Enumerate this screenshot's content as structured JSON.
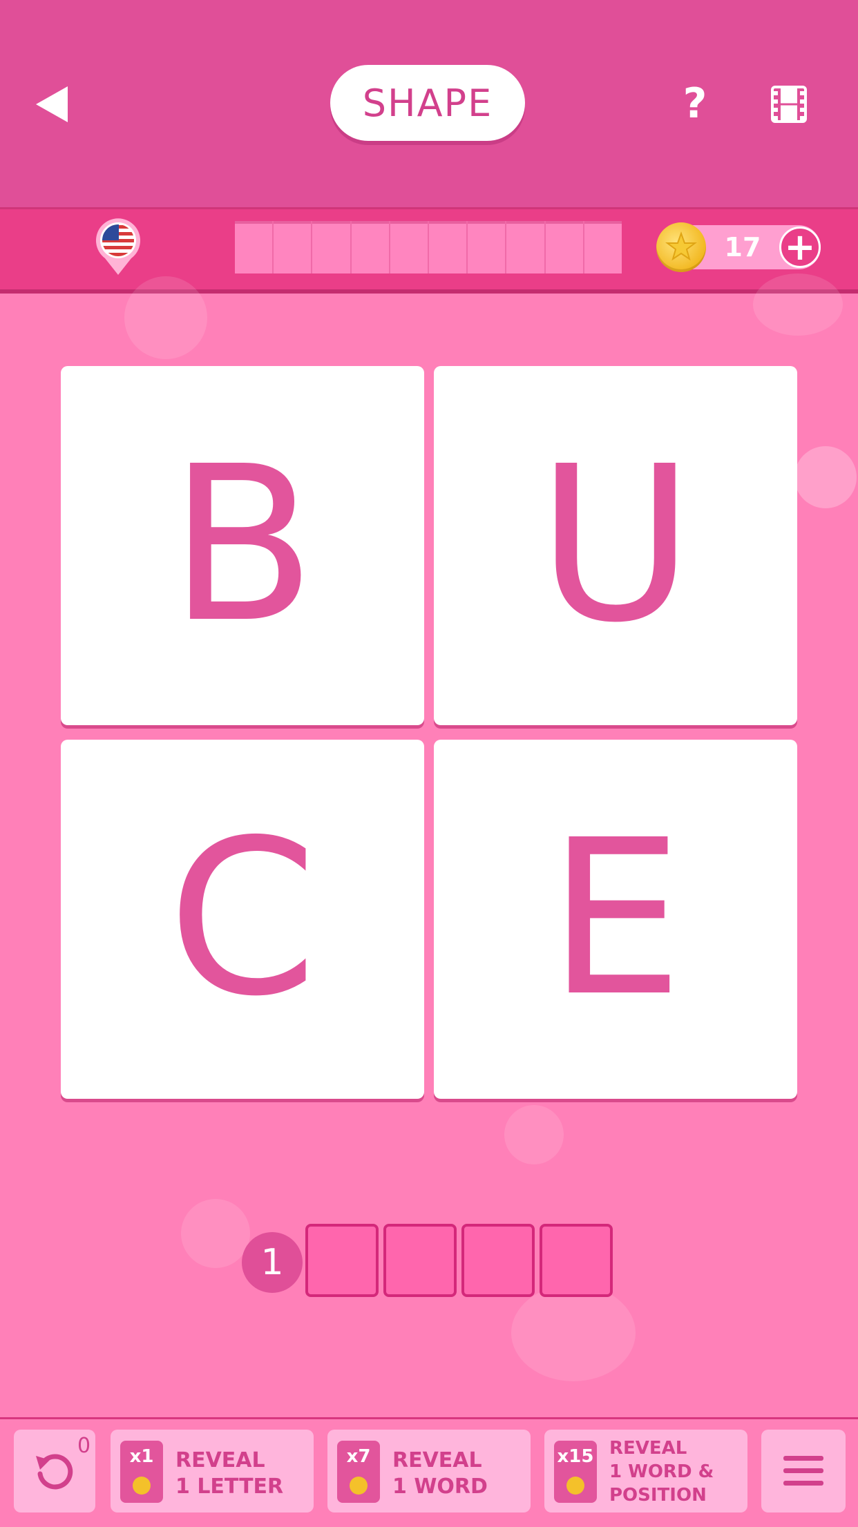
{
  "header": {
    "title": "SHAPE",
    "back_icon": "back-arrow-icon",
    "help_label": "?",
    "video_icon": "film-icon"
  },
  "status": {
    "language_icon": "us-flag-icon",
    "coins": "17",
    "add_coins_label": "+"
  },
  "tiles": [
    "B",
    "U",
    "C",
    "E"
  ],
  "answer": {
    "word_number": "1",
    "letter_count": 4
  },
  "toolbar": {
    "undo_count": "0",
    "hints": [
      {
        "cost": "x1",
        "label_line1": "REVEAL",
        "label_line2": "1 LETTER",
        "label_line3": ""
      },
      {
        "cost": "x7",
        "label_line1": "REVEAL",
        "label_line2": "1 WORD",
        "label_line3": ""
      },
      {
        "cost": "x15",
        "label_line1": "REVEAL",
        "label_line2": "1 WORD &",
        "label_line3": "POSITION"
      }
    ],
    "menu_icon": "hamburger-menu-icon"
  },
  "colors": {
    "header": "#e04f98",
    "status_bar": "#ea3e88",
    "background": "#ff80b8",
    "accent": "#e2559c"
  }
}
